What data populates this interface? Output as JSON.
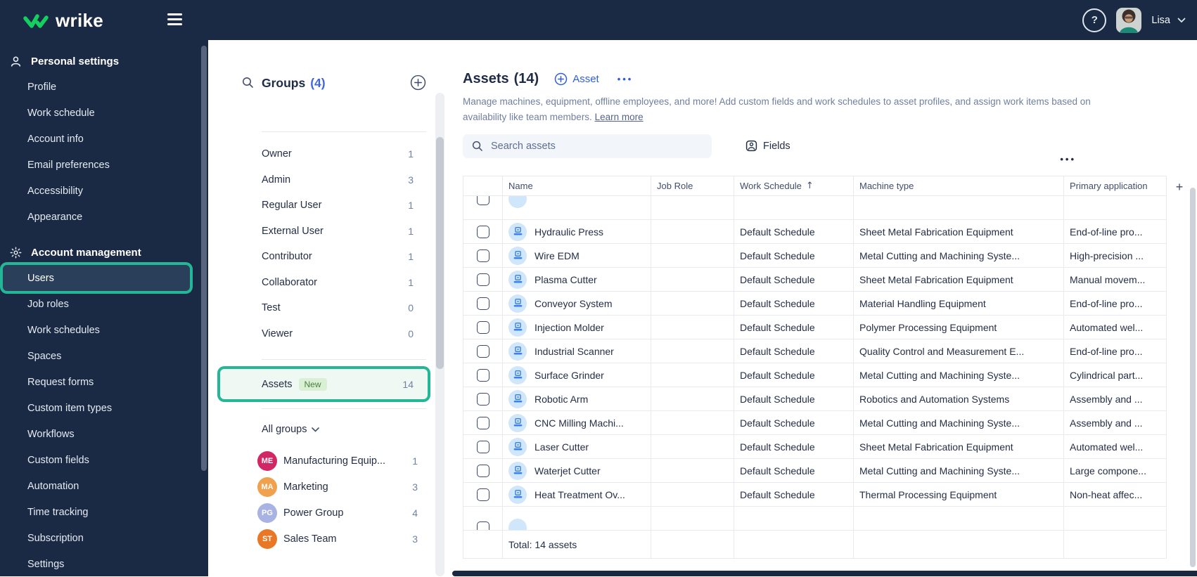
{
  "topbar": {
    "brand": "wrike",
    "help_glyph": "?",
    "user_name": "Lisa"
  },
  "icons": {
    "ellipsis_glyph": "•••",
    "sort_asc_glyph": "↑",
    "plus_glyph": "+"
  },
  "sidebar": {
    "sections": [
      {
        "label": "Personal settings",
        "icon": "person-icon",
        "items": [
          {
            "label": "Profile"
          },
          {
            "label": "Work schedule"
          },
          {
            "label": "Account info"
          },
          {
            "label": "Email preferences"
          },
          {
            "label": "Accessibility"
          },
          {
            "label": "Appearance"
          }
        ]
      },
      {
        "label": "Account management",
        "icon": "gear-icon",
        "items": [
          {
            "label": "Users",
            "selected": true
          },
          {
            "label": "Job roles"
          },
          {
            "label": "Work schedules"
          },
          {
            "label": "Spaces"
          },
          {
            "label": "Request forms"
          },
          {
            "label": "Custom item types"
          },
          {
            "label": "Workflows"
          },
          {
            "label": "Custom fields"
          },
          {
            "label": "Automation"
          },
          {
            "label": "Time tracking"
          },
          {
            "label": "Subscription"
          },
          {
            "label": "Settings"
          }
        ]
      }
    ]
  },
  "groups_panel": {
    "title": "Groups",
    "count": "(4)",
    "roles": [
      {
        "label": "Owner",
        "count": "1"
      },
      {
        "label": "Admin",
        "count": "3"
      },
      {
        "label": "Regular User",
        "count": "1"
      },
      {
        "label": "External User",
        "count": "1"
      },
      {
        "label": "Contributor",
        "count": "1"
      },
      {
        "label": "Collaborator",
        "count": "1"
      },
      {
        "label": "Test",
        "count": "0"
      },
      {
        "label": "Viewer",
        "count": "0"
      }
    ],
    "assets_item": {
      "label": "Assets",
      "badge": "New",
      "count": "14"
    },
    "all_groups_label": "All groups",
    "groups": [
      {
        "initials": "ME",
        "name": "Manufacturing Equip...",
        "count": "1",
        "color": "#d12764"
      },
      {
        "initials": "MA",
        "name": "Marketing",
        "count": "3",
        "color": "#f0a14e"
      },
      {
        "initials": "PG",
        "name": "Power Group",
        "count": "4",
        "color": "#a9b3e3"
      },
      {
        "initials": "ST",
        "name": "Sales Team",
        "count": "3",
        "color": "#e97826"
      }
    ]
  },
  "main": {
    "title": "Assets",
    "count": "(14)",
    "add_label": "Asset",
    "description": "Manage machines, equipment, offline employees, and more! Add custom fields and work schedules to asset profiles, and assign work items based on availability like team members.",
    "learn_more_label": "Learn more",
    "search_placeholder": "Search assets",
    "fields_label": "Fields",
    "table": {
      "columns": [
        "Name",
        "Job Role",
        "Work Schedule",
        "Machine type",
        "Primary application"
      ],
      "sorted_column": "Work Schedule",
      "rows": [
        {
          "name": "Hydraulic Press",
          "job_role": "",
          "work_schedule": "Default Schedule",
          "machine_type": "Sheet Metal Fabrication Equipment",
          "primary_application": "End-of-line pro..."
        },
        {
          "name": "Wire EDM",
          "job_role": "",
          "work_schedule": "Default Schedule",
          "machine_type": "Metal Cutting and Machining Syste...",
          "primary_application": "High-precision ..."
        },
        {
          "name": "Plasma Cutter",
          "job_role": "",
          "work_schedule": "Default Schedule",
          "machine_type": "Sheet Metal Fabrication Equipment",
          "primary_application": "Manual movem..."
        },
        {
          "name": "Conveyor System",
          "job_role": "",
          "work_schedule": "Default Schedule",
          "machine_type": "Material Handling Equipment",
          "primary_application": "End-of-line pro..."
        },
        {
          "name": "Injection Molder",
          "job_role": "",
          "work_schedule": "Default Schedule",
          "machine_type": "Polymer Processing Equipment",
          "primary_application": "Automated wel..."
        },
        {
          "name": "Industrial Scanner",
          "job_role": "",
          "work_schedule": "Default Schedule",
          "machine_type": "Quality Control and Measurement E...",
          "primary_application": "End-of-line pro..."
        },
        {
          "name": "Surface Grinder",
          "job_role": "",
          "work_schedule": "Default Schedule",
          "machine_type": "Metal Cutting and Machining Syste...",
          "primary_application": "Cylindrical part..."
        },
        {
          "name": "Robotic Arm",
          "job_role": "",
          "work_schedule": "Default Schedule",
          "machine_type": "Robotics and Automation Systems",
          "primary_application": "Assembly and ..."
        },
        {
          "name": "CNC Milling Machi...",
          "job_role": "",
          "work_schedule": "Default Schedule",
          "machine_type": "Metal Cutting and Machining Syste...",
          "primary_application": "Assembly and ..."
        },
        {
          "name": "Laser Cutter",
          "job_role": "",
          "work_schedule": "Default Schedule",
          "machine_type": "Sheet Metal Fabrication Equipment",
          "primary_application": "Automated wel..."
        },
        {
          "name": "Waterjet Cutter",
          "job_role": "",
          "work_schedule": "Default Schedule",
          "machine_type": "Metal Cutting and Machining Syste...",
          "primary_application": "Large compone..."
        },
        {
          "name": "Heat Treatment Ov...",
          "job_role": "",
          "work_schedule": "Default Schedule",
          "machine_type": "Thermal Processing Equipment",
          "primary_application": "Non-heat affec..."
        }
      ],
      "total_label": "Total: 14 assets"
    }
  },
  "colors": {
    "navy_bg": "#1b2a44",
    "selected_navy": "#2a3f59",
    "annotation_teal": "#23b798",
    "accent_blue": "#2e5ee0",
    "count_blue_gray": "#6f82a6",
    "mint_highlight": "#f0f8f4",
    "badge_green_bg": "#d9f0d4",
    "badge_green_text": "#4a7d44",
    "asset_icon_bg": "#cfe6fb",
    "asset_icon_stroke": "#3b82e8"
  }
}
